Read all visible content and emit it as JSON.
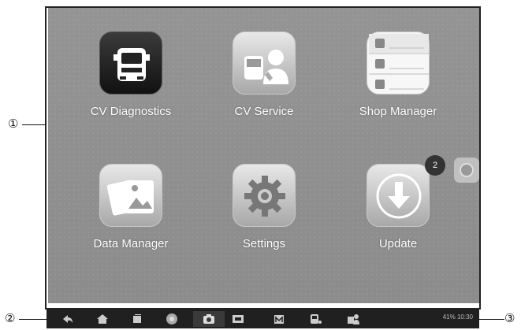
{
  "callouts": {
    "c1": "①",
    "c2": "②",
    "c3": "③"
  },
  "apps": {
    "cv_diagnostics": "CV Diagnostics",
    "cv_service": "CV Service",
    "shop_manager": "Shop Manager",
    "data_manager": "Data Manager",
    "settings": "Settings",
    "update": "Update"
  },
  "notification_badge": "2",
  "status_bar": {
    "text": "41%   10:30"
  },
  "navbar_icons": [
    "back-icon",
    "home-icon",
    "recent-apps-icon",
    "chrome-icon",
    "camera-icon",
    "screen-mirror-icon",
    "maxifix-icon",
    "vci-icon",
    "remote-support-icon"
  ],
  "colors": {
    "screen": "#8f8f8f",
    "navbar": "#202020"
  }
}
